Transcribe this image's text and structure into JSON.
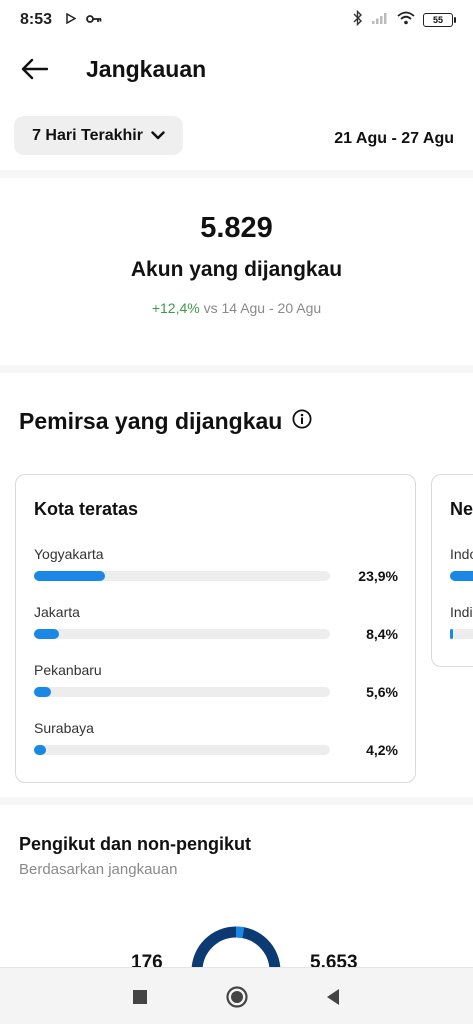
{
  "status_bar": {
    "time": "8:53",
    "battery": "55",
    "icons": [
      "play-icon",
      "key-icon",
      "bluetooth-icon",
      "signal-icon",
      "wifi-icon",
      "battery-icon"
    ]
  },
  "header": {
    "title": "Jangkauan",
    "back_icon": "arrow-left-icon"
  },
  "period": {
    "selected": "7 Hari Terakhir",
    "date_range": "21 Agu - 27 Agu"
  },
  "summary": {
    "value": "5.829",
    "label": "Akun yang dijangkau",
    "change": "+12,4%",
    "compare_text": " vs 14 Agu - 20 Agu"
  },
  "audience": {
    "title": "Pemirsa yang dijangkau",
    "info_icon": "info-icon"
  },
  "top_cities": {
    "title": "Kota teratas",
    "items": [
      {
        "name": "Yogyakarta",
        "pct": "23,9%",
        "value": 23.9
      },
      {
        "name": "Jakarta",
        "pct": "8,4%",
        "value": 8.4
      },
      {
        "name": "Pekanbaru",
        "pct": "5,6%",
        "value": 5.6
      },
      {
        "name": "Surabaya",
        "pct": "4,2%",
        "value": 4.2
      }
    ]
  },
  "top_countries": {
    "title": "Ne",
    "items": [
      {
        "name": "Indo",
        "value": 0.9
      },
      {
        "name": "Indi",
        "value": 0.02
      }
    ]
  },
  "followers": {
    "title": "Pengikut dan non-pengikut",
    "subtitle": "Berdasarkan jangkauan",
    "left_value": "176",
    "right_value": "5.653",
    "followers_count": 176,
    "non_followers_count": 5653,
    "colors": {
      "followers": "#1b87e6",
      "non_followers": "#0c3b73"
    }
  },
  "colors": {
    "accent": "#1b87e6",
    "positive": "#3d9b4b"
  }
}
